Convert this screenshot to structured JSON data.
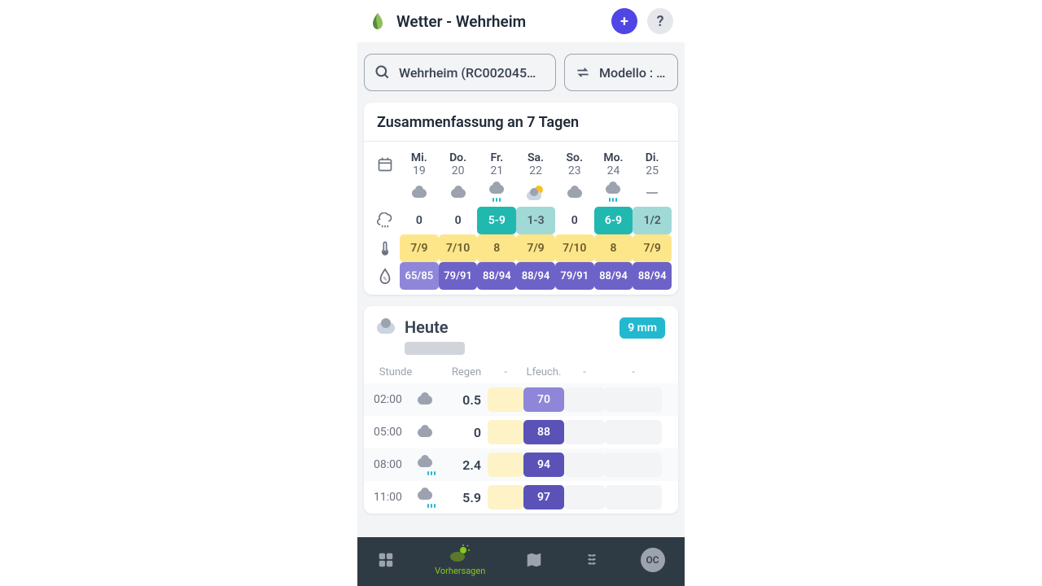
{
  "header": {
    "title": "Wetter - Wehrheim",
    "add_label": "+",
    "help_label": "?"
  },
  "location_pill": "Wehrheim (RC002045…",
  "model_pill": "Modello : Met",
  "summary": {
    "title": "Zusammenfassung an 7 Tagen",
    "days": [
      {
        "abbr": "Mi.",
        "num": "19",
        "weather": "cloud",
        "rain": "0",
        "rain_cls": "rain-none",
        "temp": "7/9",
        "hum": "65/85",
        "hum_cls": "hum-light"
      },
      {
        "abbr": "Do.",
        "num": "20",
        "weather": "cloud",
        "rain": "0",
        "rain_cls": "rain-none",
        "temp": "7/10",
        "hum": "79/91",
        "hum_cls": "hum-box"
      },
      {
        "abbr": "Fr.",
        "num": "21",
        "weather": "rain",
        "rain": "5-9",
        "rain_cls": "rain-teal",
        "temp": "8",
        "hum": "88/94",
        "hum_cls": "hum-box"
      },
      {
        "abbr": "Sa.",
        "num": "22",
        "weather": "partly",
        "rain": "1-3",
        "rain_cls": "rain-lteal",
        "temp": "7/9",
        "hum": "88/94",
        "hum_cls": "hum-box"
      },
      {
        "abbr": "So.",
        "num": "23",
        "weather": "cloud",
        "rain": "0",
        "rain_cls": "rain-none",
        "temp": "7/10",
        "hum": "79/91",
        "hum_cls": "hum-box"
      },
      {
        "abbr": "Mo.",
        "num": "24",
        "weather": "rain",
        "rain": "6-9",
        "rain_cls": "rain-teal",
        "temp": "8",
        "hum": "88/94",
        "hum_cls": "hum-box"
      },
      {
        "abbr": "Di.",
        "num": "25",
        "weather": "dash",
        "rain": "1/2",
        "rain_cls": "rain-lteal",
        "temp": "7/9",
        "hum": "88/94",
        "hum_cls": "hum-box"
      }
    ]
  },
  "today": {
    "title": "Heute",
    "rain_total": "9 mm",
    "columns": {
      "hour": "Stunde",
      "rain": "Regen",
      "a": "-",
      "hum": "Lfeuch.",
      "b": "-",
      "c": "-"
    },
    "rows": [
      {
        "hour": "02:00",
        "icon": "cloud",
        "rain": "0.5",
        "hum": "70",
        "hum_bg": "#8f86d9"
      },
      {
        "hour": "05:00",
        "icon": "cloud",
        "rain": "0",
        "hum": "88",
        "hum_bg": "#5b52b8"
      },
      {
        "hour": "08:00",
        "icon": "rain",
        "rain": "2.4",
        "hum": "94",
        "hum_bg": "#5b52b8"
      },
      {
        "hour": "11:00",
        "icon": "rain",
        "rain": "5.9",
        "hum": "97",
        "hum_bg": "#5b52b8"
      }
    ]
  },
  "nav": {
    "forecast_label": "Vorhersagen",
    "avatar": "OC"
  }
}
